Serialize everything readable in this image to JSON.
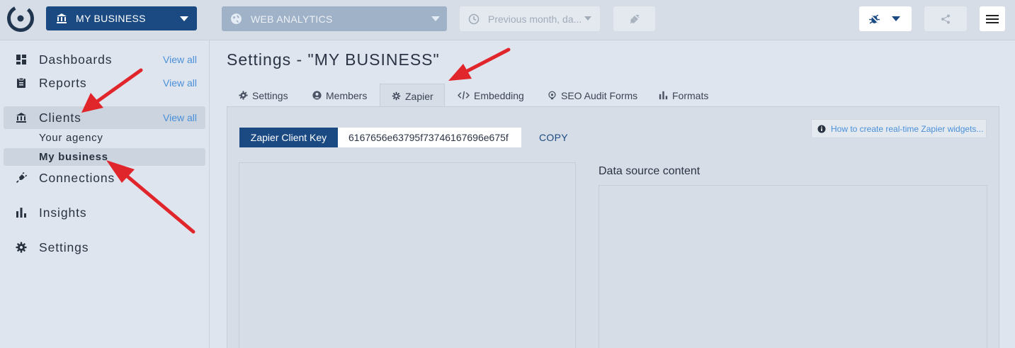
{
  "topbar": {
    "client_select": "MY BUSINESS",
    "datasource_select": "WEB ANALYTICS",
    "date_select": "Previous month, da..."
  },
  "sidebar": {
    "items": [
      {
        "label": "Dashboards",
        "view_all": "View all",
        "icon": "dashboard-icon"
      },
      {
        "label": "Reports",
        "view_all": "View all",
        "icon": "report-icon"
      },
      {
        "label": "Clients",
        "view_all": "View all",
        "icon": "bank-icon"
      },
      {
        "label": "Connections",
        "icon": "plug-icon"
      },
      {
        "label": "Insights",
        "icon": "bar-chart-icon"
      },
      {
        "label": "Settings",
        "icon": "gear-icon"
      }
    ],
    "client_subitems": [
      "Your agency",
      "My business"
    ]
  },
  "main": {
    "title": "Settings - \"MY BUSINESS\"",
    "tabs": [
      {
        "label": "Settings",
        "icon": "gear-icon"
      },
      {
        "label": "Members",
        "icon": "user-icon"
      },
      {
        "label": "Zapier",
        "icon": "zapier-icon"
      },
      {
        "label": "Embedding",
        "icon": "code-icon"
      },
      {
        "label": "SEO Audit Forms",
        "icon": "seo-icon"
      },
      {
        "label": "Formats",
        "icon": "bar-chart-icon"
      }
    ],
    "active_tab": "Zapier",
    "zapier": {
      "key_label": "Zapier Client Key",
      "key_value": "6167656e63795f73746167696e675f",
      "copy_label": "COPY",
      "help_link": "How to create real-time Zapier widgets...",
      "data_source_title": "Data source content"
    }
  },
  "colors": {
    "brand": "#1b4a82",
    "link": "#4a90d9",
    "annotation_arrow": "#e0252b"
  }
}
